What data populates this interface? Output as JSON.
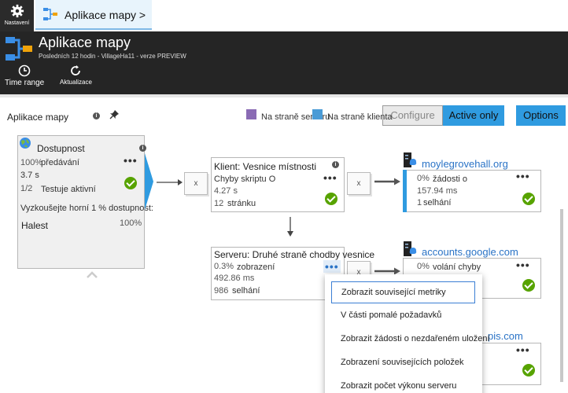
{
  "nav": {
    "settings_label": "Nastavení",
    "breadcrumb": "Aplikace mapy >"
  },
  "header": {
    "title": "Aplikace mapy",
    "subtitle": "Posledních 12 hodin - VillageHa11 - verze PREVIEW",
    "commands": [
      {
        "label": "Time range"
      },
      {
        "label": "Aktualizace"
      }
    ]
  },
  "panel": {
    "title": "Aplikace mapy",
    "legend": [
      {
        "label": "Na straně serveru",
        "color": "#8a6bb4"
      },
      {
        "label": "Na straně klienta",
        "color": "#4a9bd6"
      }
    ],
    "buttons": {
      "configure": "Configure",
      "active_only": "Active only",
      "options": "Options"
    }
  },
  "availability": {
    "title": "Dostupnost",
    "stat1_value": "100%",
    "stat1_label": "předávání",
    "stat2_value": "3.7 s",
    "stat3_value": "1/2",
    "stat3_label": "Testuje aktivní",
    "cta": "Vyzkoušejte horní 1 % dostupnost:",
    "row_label": "Halest",
    "row_value": "100%"
  },
  "client_node": {
    "title": "Klient: Vesnice místnosti",
    "line1": "Chyby skriptu O",
    "line2": "4.27 s",
    "line3_value": "12",
    "line3_label": "stránku"
  },
  "server_node": {
    "title": "Serveru: Druhé straně chodby vesnice",
    "line1_value": "0.3%",
    "line1_label": "zobrazení",
    "line2": "492.86 ms",
    "line3_value": "986",
    "line3_label": "selhání"
  },
  "remote1": {
    "name": "moylegrovehall.org",
    "line1_value": "0%",
    "line1_label": "žádosti o",
    "line2": "157.94 ms",
    "line3_value": "1",
    "line3_label": "selhání"
  },
  "remote2": {
    "name": "accounts.google.com",
    "line1_value": "0%",
    "line1_label": "volání chyby"
  },
  "remote3": {
    "name": "pis.com"
  },
  "connector_label": "x",
  "context_menu": [
    "Zobrazit související metriky",
    "V části pomalé požadavků",
    "Zobrazit žádosti o nezdařeném uložení",
    "Zobrazení souvisejících položek",
    "Zobrazit počet výkonu serveru"
  ],
  "colors": {
    "accent": "#2f9be0",
    "button_active": "#2f9be0",
    "header_bg": "#252525",
    "status_ok": "#57a300"
  }
}
